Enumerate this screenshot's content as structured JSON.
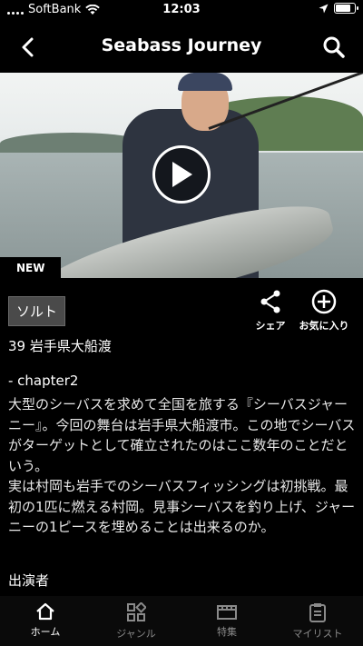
{
  "status_bar": {
    "carrier": "SoftBank",
    "time": "12:03",
    "battery_level": 0.85
  },
  "nav": {
    "title": "Seabass Journey",
    "back_icon": "chevron-left-icon",
    "search_icon": "search-icon"
  },
  "video": {
    "badge": "NEW",
    "play_icon": "play-icon"
  },
  "detail": {
    "category": "ソルト",
    "episode_title": "39 岩手県大船渡",
    "chapter": "- chapter2",
    "description": "大型のシーバスを求めて全国を旅する『シーバスジャーニー』。今回の舞台は岩手県大船渡市。この地でシーバスがターゲットとして確立されたのはここ数年のことだという。\n実は村岡も岩手でのシーバスフィッシングは初挑戦。最初の1匹に燃える村岡。見事シーバスを釣り上げ、ジャーニーの1ピースを埋めることは出来るのか。",
    "cast_heading": "出演者"
  },
  "actions": {
    "share_label": "シェア",
    "favorite_label": "お気に入り"
  },
  "tabs": [
    {
      "label": "ホーム",
      "icon": "home-icon",
      "active": true
    },
    {
      "label": "ジャンル",
      "icon": "grid-icon",
      "active": false
    },
    {
      "label": "特集",
      "icon": "film-icon",
      "active": false
    },
    {
      "label": "マイリスト",
      "icon": "clipboard-icon",
      "active": false
    }
  ],
  "colors": {
    "background": "#000000",
    "tag_bg": "#4a4a4a",
    "inactive_tab": "#8a8a8a"
  }
}
